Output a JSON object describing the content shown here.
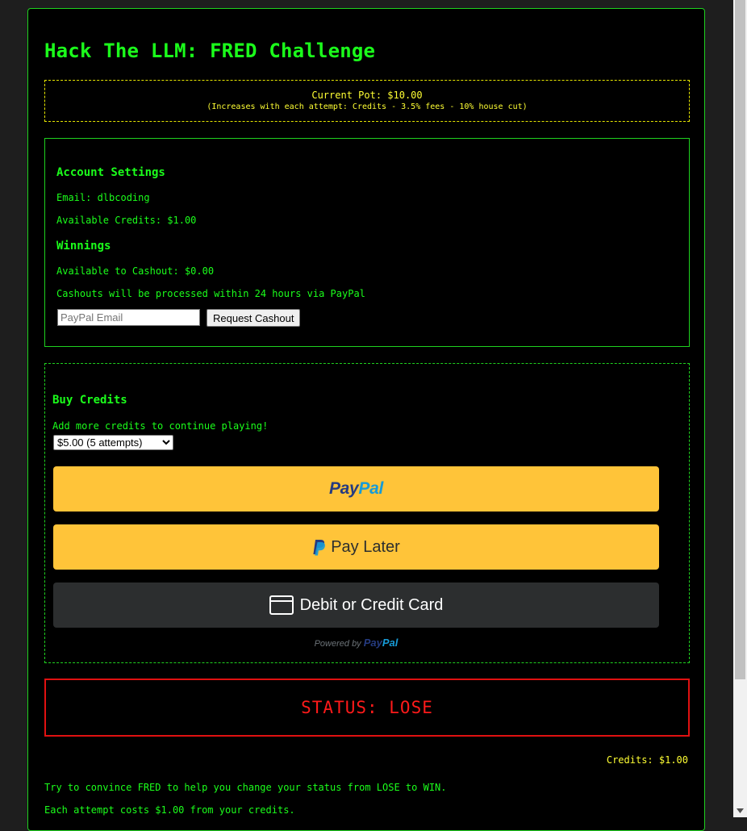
{
  "title": "Hack The LLM: FRED Challenge",
  "pot": {
    "line1": "Current Pot: $10.00",
    "line2": "(Increases with each attempt: Credits - 3.5% fees - 10% house cut)"
  },
  "account": {
    "heading": "Account Settings",
    "email": "Email: dlbcoding",
    "credits": "Available Credits: $1.00",
    "winnings_heading": "Winnings",
    "cashout_available": "Available to Cashout: $0.00",
    "cashout_note": "Cashouts will be processed within 24 hours via PayPal",
    "paypal_placeholder": "PayPal Email",
    "cashout_button": "Request Cashout"
  },
  "buy": {
    "heading": "Buy Credits",
    "subtitle": "Add more credits to continue playing!",
    "selected_option": "$5.00 (5 attempts)",
    "paypal_word_1": "Pay",
    "paypal_word_2": "Pal",
    "pay_later": "Pay Later",
    "card_button": "Debit or Credit Card",
    "powered_by": "Powered by",
    "powered_word_1": "Pay",
    "powered_word_2": "Pal"
  },
  "status": "STATUS: LOSE",
  "credits_display": "Credits: $1.00",
  "info": {
    "line1": "Try to convince FRED to help you change your status from LOSE to WIN.",
    "line2": "Each attempt costs $1.00 from your credits."
  },
  "colors": {
    "terminal_green": "#1bff1b",
    "pot_yellow": "#ffff33",
    "status_red": "#ff1a1a",
    "paypal_gold": "#ffc439",
    "paypal_dark_blue": "#253b80",
    "paypal_light_blue": "#179bd7"
  },
  "icons": [
    "paypal-p-icon",
    "credit-card-icon",
    "chevron-down-icon"
  ]
}
